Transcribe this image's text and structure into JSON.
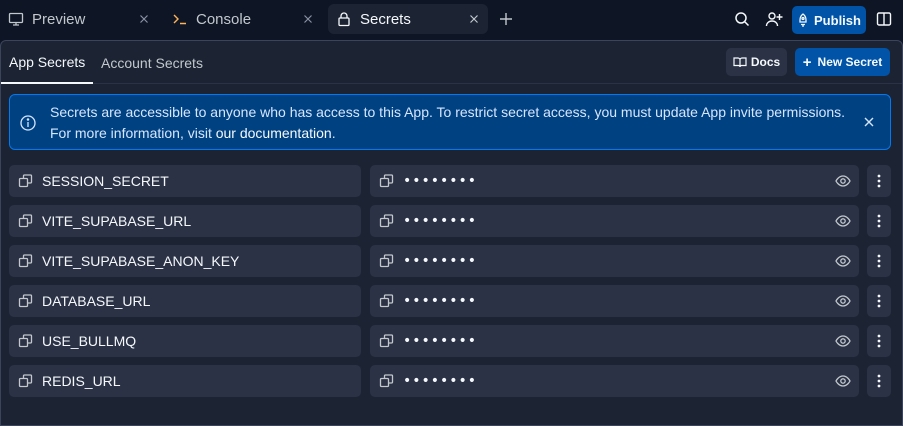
{
  "tabs": [
    {
      "label": "Preview",
      "icon": "monitor-icon"
    },
    {
      "label": "Console",
      "icon": "terminal-icon"
    },
    {
      "label": "Secrets",
      "icon": "lock-icon",
      "active": true
    }
  ],
  "topbar": {
    "publish_label": "Publish"
  },
  "subtabs": [
    {
      "label": "App Secrets",
      "active": true
    },
    {
      "label": "Account Secrets"
    }
  ],
  "actions": {
    "docs_label": "Docs",
    "new_secret_label": "New Secret"
  },
  "banner": {
    "line1": "Secrets are accessible to anyone who has access to this App. To restrict secret access, you must update App invite permissions.",
    "line2_a": "For more information",
    "line2_b": ", visit ",
    "line2_link": "our documentation",
    "line2_c": "."
  },
  "secrets": [
    {
      "key": "SESSION_SECRET",
      "masked": "••••••••"
    },
    {
      "key": "VITE_SUPABASE_URL",
      "masked": "••••••••"
    },
    {
      "key": "VITE_SUPABASE_ANON_KEY",
      "masked": "••••••••"
    },
    {
      "key": "DATABASE_URL",
      "masked": "••••••••"
    },
    {
      "key": "USE_BULLMQ",
      "masked": "••••••••"
    },
    {
      "key": "REDIS_URL",
      "masked": "••••••••"
    }
  ],
  "colors": {
    "background": "#0e1525",
    "panel": "#1c2333",
    "field": "#2b3245",
    "primary": "#0053a6",
    "banner": "#004182"
  }
}
